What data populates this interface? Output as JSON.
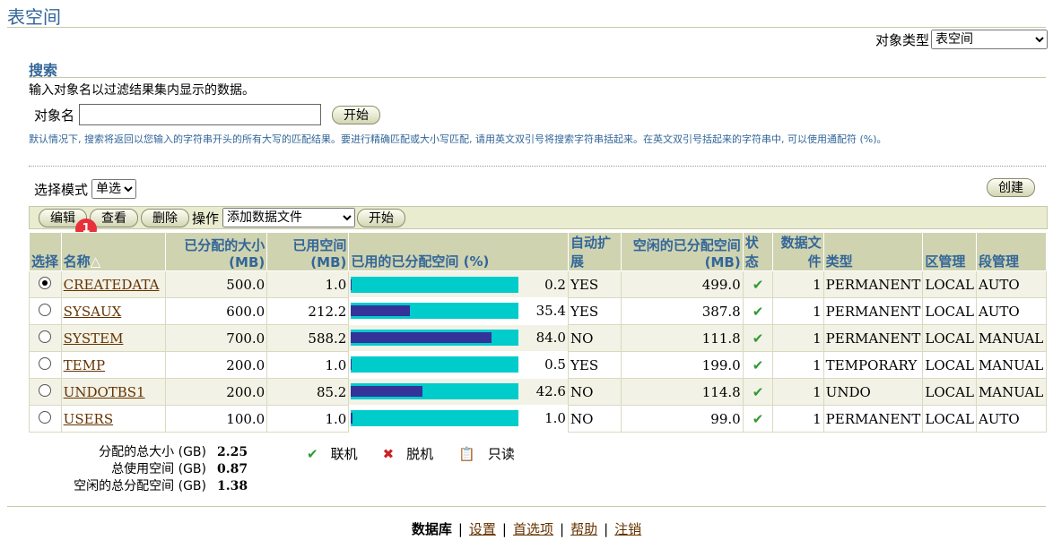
{
  "page_title": "表空间",
  "object_type": {
    "label": "对象类型",
    "selected": "表空间"
  },
  "search": {
    "title": "搜索",
    "description": "输入对象名以过滤结果集内显示的数据。",
    "object_name_label": "对象名",
    "object_name_value": "",
    "go_label": "开始",
    "hint": "默认情况下, 搜索将返回以您输入的字符串开头的所有大写的匹配结果。要进行精确匹配或大小写匹配, 请用英文双引号将搜索字符串括起来。在英文双引号括起来的字符串中, 可以使用通配符 (%)。"
  },
  "select_mode": {
    "label": "选择模式",
    "selected": "单选"
  },
  "create_label": "创建",
  "toolbar": {
    "edit_label": "编辑",
    "view_label": "查看",
    "delete_label": "删除",
    "action_label": "操作",
    "action_selected": "添加数据文件",
    "go_label": "开始"
  },
  "badge": "1",
  "table": {
    "headers": {
      "select": "选择",
      "name": "名称",
      "allocated": "已分配的大小 (MB)",
      "used": "已用空间 (MB)",
      "used_pct": "已用的已分配空间 (%)",
      "autoextend": "自动扩展",
      "free": "空闲的已分配空间 (MB)",
      "status": "状态",
      "datafiles": "数据文件",
      "type": "类型",
      "extent_mgmt": "区管理",
      "segment_mgmt": "段管理"
    },
    "rows": [
      {
        "name": "CREATEDATA",
        "allocated": "500.0",
        "used": "1.0",
        "pct": "0.2",
        "pct_value": 0.2,
        "autoextend": "YES",
        "free": "499.0",
        "datafiles": "1",
        "type": "PERMANENT",
        "extent": "LOCAL",
        "segment": "AUTO",
        "selected": true
      },
      {
        "name": "SYSAUX",
        "allocated": "600.0",
        "used": "212.2",
        "pct": "35.4",
        "pct_value": 35.4,
        "autoextend": "YES",
        "free": "387.8",
        "datafiles": "1",
        "type": "PERMANENT",
        "extent": "LOCAL",
        "segment": "AUTO",
        "selected": false
      },
      {
        "name": "SYSTEM",
        "allocated": "700.0",
        "used": "588.2",
        "pct": "84.0",
        "pct_value": 84.0,
        "autoextend": "NO",
        "free": "111.8",
        "datafiles": "1",
        "type": "PERMANENT",
        "extent": "LOCAL",
        "segment": "MANUAL",
        "selected": false
      },
      {
        "name": "TEMP",
        "allocated": "200.0",
        "used": "1.0",
        "pct": "0.5",
        "pct_value": 0.5,
        "autoextend": "YES",
        "free": "199.0",
        "datafiles": "1",
        "type": "TEMPORARY",
        "extent": "LOCAL",
        "segment": "MANUAL",
        "selected": false
      },
      {
        "name": "UNDOTBS1",
        "allocated": "200.0",
        "used": "85.2",
        "pct": "42.6",
        "pct_value": 42.6,
        "autoextend": "NO",
        "free": "114.8",
        "datafiles": "1",
        "type": "UNDO",
        "extent": "LOCAL",
        "segment": "MANUAL",
        "selected": false
      },
      {
        "name": "USERS",
        "allocated": "100.0",
        "used": "1.0",
        "pct": "1.0",
        "pct_value": 1.0,
        "autoextend": "NO",
        "free": "99.0",
        "datafiles": "1",
        "type": "PERMANENT",
        "extent": "LOCAL",
        "segment": "AUTO",
        "selected": false
      }
    ]
  },
  "summary": {
    "total_allocated_label": "分配的总大小 (GB)",
    "total_allocated": "2.25",
    "total_used_label": "总使用空间 (GB)",
    "total_used": "0.87",
    "total_free_label": "空闲的总分配空间 (GB)",
    "total_free": "1.38"
  },
  "legend": {
    "online": "联机",
    "offline": "脱机",
    "readonly": "只读"
  },
  "footer": [
    "数据库",
    "设置",
    "首选项",
    "帮助",
    "注销"
  ],
  "colors": {
    "header_bg": "#cfd3b0",
    "title_blue": "#336699",
    "bar_bg": "#00cccc",
    "bar_fill": "#333399",
    "link": "#663300"
  }
}
